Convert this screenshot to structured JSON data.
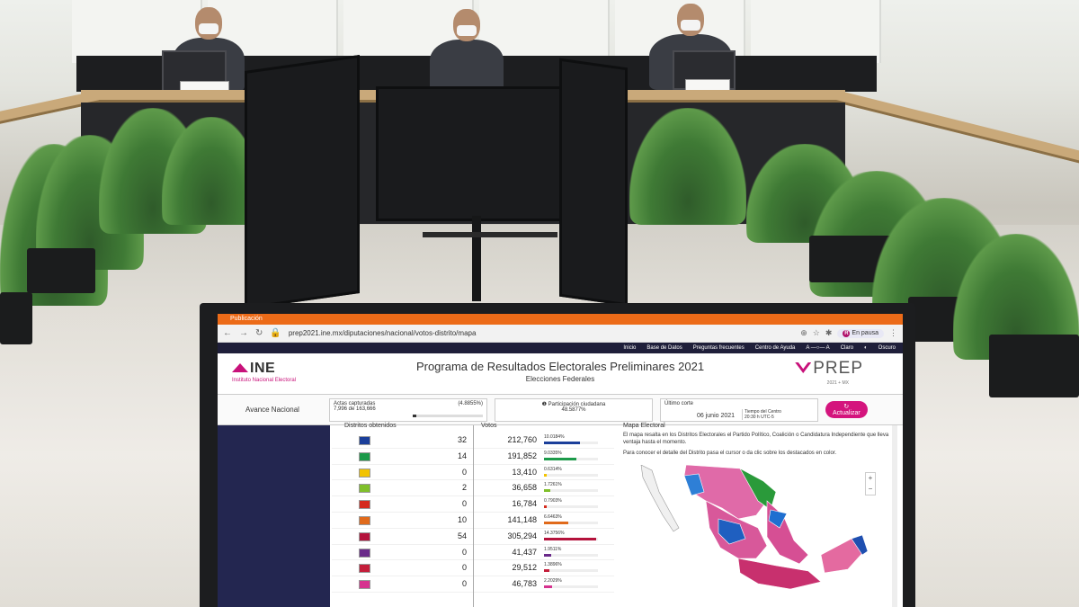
{
  "browser": {
    "tab_label": "Publicación",
    "url": "prep2021.ine.mx/diputaciones/nacional/votos-distrito/mapa",
    "profile_label": "En pausa",
    "profile_initial": "R"
  },
  "site_nav": {
    "items": [
      "Inicio",
      "Base de Datos",
      "Preguntas frecuentes",
      "Centro de Ayuda"
    ],
    "theme_light": "Claro",
    "theme_dark": "Oscuro"
  },
  "header": {
    "ine_logo": "INE",
    "ine_sub": "Instituto Nacional Electoral",
    "title": "Programa de Resultados Electorales Preliminares 2021",
    "subtitle": "Elecciones Federales",
    "prep_logo": "PREP",
    "prep_sub": "2021 + MX"
  },
  "stats": {
    "avance_label": "Avance Nacional",
    "actas_label": "Actas capturadas",
    "actas_pct": "(4.8855%)",
    "actas_value": "7,996 de 163,666",
    "actas_progress": 0.048855,
    "participacion_label": "Participación ciudadana",
    "participacion_value": "48.5877%",
    "corte_label": "Último corte",
    "corte_value": "06 junio 2021",
    "tiempo_label": "Tiempo del Centro",
    "tiempo_value": "20:30 h UTC-5",
    "update_button": "Actualizar"
  },
  "results": {
    "col_distritos": "Distritos obtenidos",
    "col_votos": "Votos",
    "rows": [
      {
        "distritos": "32",
        "votos": "212,760",
        "pct": "10.0184%",
        "fraction": 0.100184,
        "color": "#1b3f9a"
      },
      {
        "distritos": "14",
        "votos": "191,852",
        "pct": "9.0335%",
        "fraction": 0.090335,
        "color": "#1c9a4a"
      },
      {
        "distritos": "0",
        "votos": "13,410",
        "pct": "0.6314%",
        "fraction": 0.006314,
        "color": "#f2c300"
      },
      {
        "distritos": "2",
        "votos": "36,658",
        "pct": "1.7261%",
        "fraction": 0.017261,
        "color": "#7fbf2a"
      },
      {
        "distritos": "0",
        "votos": "16,784",
        "pct": "0.7903%",
        "fraction": 0.007903,
        "color": "#d52b1e"
      },
      {
        "distritos": "10",
        "votos": "141,148",
        "pct": "6.6463%",
        "fraction": 0.066463,
        "color": "#e06a1b"
      },
      {
        "distritos": "54",
        "votos": "305,294",
        "pct": "14.3756%",
        "fraction": 0.143756,
        "color": "#b4123b"
      },
      {
        "distritos": "0",
        "votos": "41,437",
        "pct": "1.9511%",
        "fraction": 0.019511,
        "color": "#6a2a8a"
      },
      {
        "distritos": "0",
        "votos": "29,512",
        "pct": "1.3896%",
        "fraction": 0.013896,
        "color": "#c41e3a"
      },
      {
        "distritos": "0",
        "votos": "46,783",
        "pct": "2.2029%",
        "fraction": 0.022029,
        "color": "#d6338f"
      }
    ]
  },
  "map": {
    "title": "Mapa Electoral",
    "text1": "El mapa resalta en los Distritos Electorales el Partido Político, Coalición o Candidatura Independiente que lleva ventaja hasta el momento.",
    "text2": "Para conocer el detalle del Distrito pasa el cursor o da clic sobre los destacados en color.",
    "zoom_in": "+",
    "zoom_out": "−"
  }
}
